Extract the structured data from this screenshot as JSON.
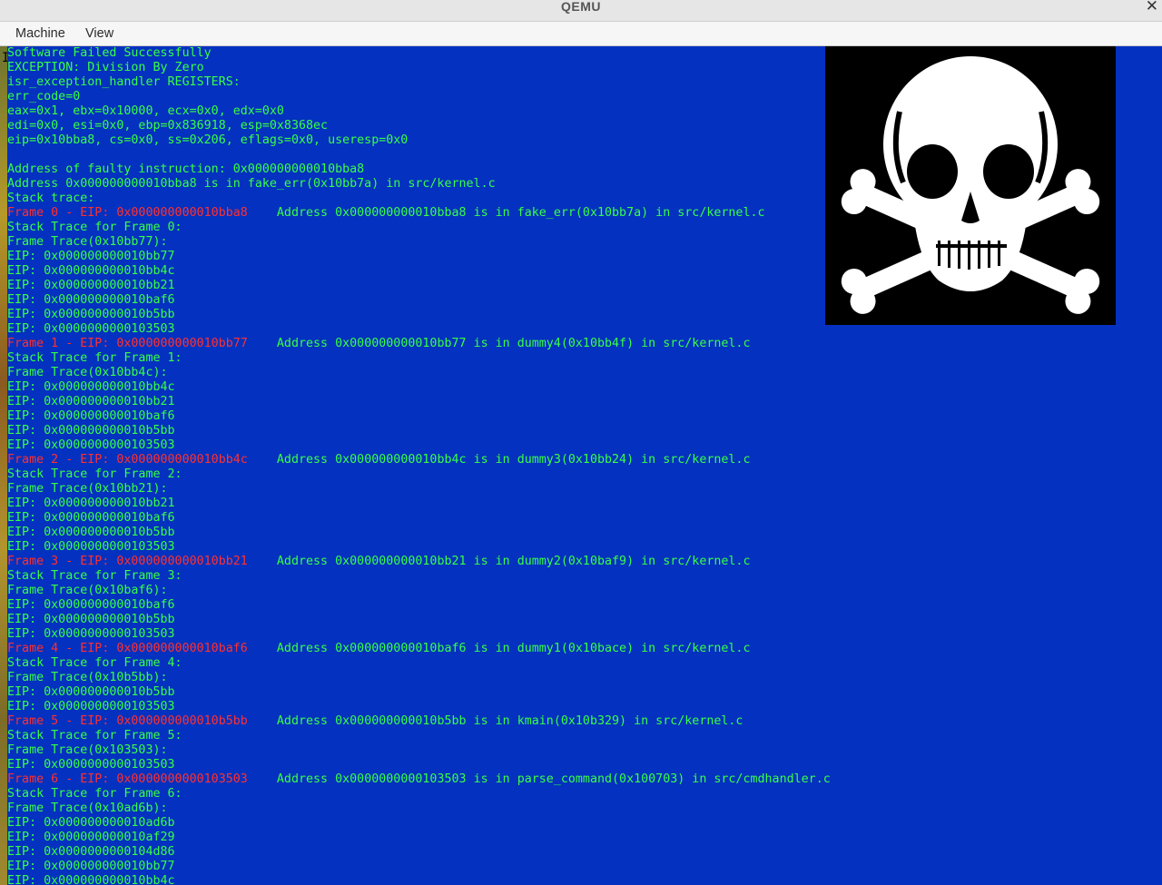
{
  "window": {
    "title": "QEMU",
    "close_symbol": "✕"
  },
  "menu": {
    "items": [
      "Machine",
      "View"
    ]
  },
  "colors": {
    "screen_bg": "#0431c0",
    "text": "#37ff45",
    "frame_text": "#ff3030"
  },
  "console": {
    "lines": [
      {
        "t": "Software Failed Successfully",
        "c": "g"
      },
      {
        "t": "EXCEPTION: Division By Zero",
        "c": "g"
      },
      {
        "t": "isr_exception_handler REGISTERS:",
        "c": "g"
      },
      {
        "t": "err_code=0",
        "c": "g"
      },
      {
        "t": "eax=0x1, ebx=0x10000, ecx=0x0, edx=0x0",
        "c": "g"
      },
      {
        "t": "edi=0x0, esi=0x0, ebp=0x836918, esp=0x8368ec",
        "c": "g"
      },
      {
        "t": "eip=0x10bba8, cs=0x0, ss=0x206, eflags=0x0, useresp=0x0",
        "c": "g"
      },
      {
        "t": "",
        "c": "g"
      },
      {
        "t": "Address of faulty instruction: 0x000000000010bba8",
        "c": "g"
      },
      {
        "t": "Address 0x000000000010bba8 is in fake_err(0x10bb7a) in src/kernel.c",
        "c": "g"
      },
      {
        "t": "Stack trace:",
        "c": "g"
      },
      {
        "t": "Frame 0 - EIP: 0x000000000010bba8",
        "c": "r",
        "a": "    Address 0x000000000010bba8 is in fake_err(0x10bb7a) in src/kernel.c"
      },
      {
        "t": "Stack Trace for Frame 0:",
        "c": "g"
      },
      {
        "t": "Frame Trace(0x10bb77):",
        "c": "g"
      },
      {
        "t": "EIP: 0x000000000010bb77",
        "c": "g"
      },
      {
        "t": "EIP: 0x000000000010bb4c",
        "c": "g"
      },
      {
        "t": "EIP: 0x000000000010bb21",
        "c": "g"
      },
      {
        "t": "EIP: 0x000000000010baf6",
        "c": "g"
      },
      {
        "t": "EIP: 0x000000000010b5bb",
        "c": "g"
      },
      {
        "t": "EIP: 0x0000000000103503",
        "c": "g"
      },
      {
        "t": "Frame 1 - EIP: 0x000000000010bb77",
        "c": "r",
        "a": "    Address 0x000000000010bb77 is in dummy4(0x10bb4f) in src/kernel.c"
      },
      {
        "t": "Stack Trace for Frame 1:",
        "c": "g"
      },
      {
        "t": "Frame Trace(0x10bb4c):",
        "c": "g"
      },
      {
        "t": "EIP: 0x000000000010bb4c",
        "c": "g"
      },
      {
        "t": "EIP: 0x000000000010bb21",
        "c": "g"
      },
      {
        "t": "EIP: 0x000000000010baf6",
        "c": "g"
      },
      {
        "t": "EIP: 0x000000000010b5bb",
        "c": "g"
      },
      {
        "t": "EIP: 0x0000000000103503",
        "c": "g"
      },
      {
        "t": "Frame 2 - EIP: 0x000000000010bb4c",
        "c": "r",
        "a": "    Address 0x000000000010bb4c is in dummy3(0x10bb24) in src/kernel.c"
      },
      {
        "t": "Stack Trace for Frame 2:",
        "c": "g"
      },
      {
        "t": "Frame Trace(0x10bb21):",
        "c": "g"
      },
      {
        "t": "EIP: 0x000000000010bb21",
        "c": "g"
      },
      {
        "t": "EIP: 0x000000000010baf6",
        "c": "g"
      },
      {
        "t": "EIP: 0x000000000010b5bb",
        "c": "g"
      },
      {
        "t": "EIP: 0x0000000000103503",
        "c": "g"
      },
      {
        "t": "Frame 3 - EIP: 0x000000000010bb21",
        "c": "r",
        "a": "    Address 0x000000000010bb21 is in dummy2(0x10baf9) in src/kernel.c"
      },
      {
        "t": "Stack Trace for Frame 3:",
        "c": "g"
      },
      {
        "t": "Frame Trace(0x10baf6):",
        "c": "g"
      },
      {
        "t": "EIP: 0x000000000010baf6",
        "c": "g"
      },
      {
        "t": "EIP: 0x000000000010b5bb",
        "c": "g"
      },
      {
        "t": "EIP: 0x0000000000103503",
        "c": "g"
      },
      {
        "t": "Frame 4 - EIP: 0x000000000010baf6",
        "c": "r",
        "a": "    Address 0x000000000010baf6 is in dummy1(0x10bace) in src/kernel.c"
      },
      {
        "t": "Stack Trace for Frame 4:",
        "c": "g"
      },
      {
        "t": "Frame Trace(0x10b5bb):",
        "c": "g"
      },
      {
        "t": "EIP: 0x000000000010b5bb",
        "c": "g"
      },
      {
        "t": "EIP: 0x0000000000103503",
        "c": "g"
      },
      {
        "t": "Frame 5 - EIP: 0x000000000010b5bb",
        "c": "r",
        "a": "    Address 0x000000000010b5bb is in kmain(0x10b329) in src/kernel.c"
      },
      {
        "t": "Stack Trace for Frame 5:",
        "c": "g"
      },
      {
        "t": "Frame Trace(0x103503):",
        "c": "g"
      },
      {
        "t": "EIP: 0x0000000000103503",
        "c": "g"
      },
      {
        "t": "Frame 6 - EIP: 0x0000000000103503",
        "c": "r",
        "a": "    Address 0x0000000000103503 is in parse_command(0x100703) in src/cmdhandler.c"
      },
      {
        "t": "Stack Trace for Frame 6:",
        "c": "g"
      },
      {
        "t": "Frame Trace(0x10ad6b):",
        "c": "g"
      },
      {
        "t": "EIP: 0x000000000010ad6b",
        "c": "g"
      },
      {
        "t": "EIP: 0x000000000010af29",
        "c": "g"
      },
      {
        "t": "EIP: 0x0000000000104d86",
        "c": "g"
      },
      {
        "t": "EIP: 0x000000000010bb77",
        "c": "g"
      },
      {
        "t": "EIP: 0x000000000010bb4c",
        "c": "g"
      }
    ]
  }
}
